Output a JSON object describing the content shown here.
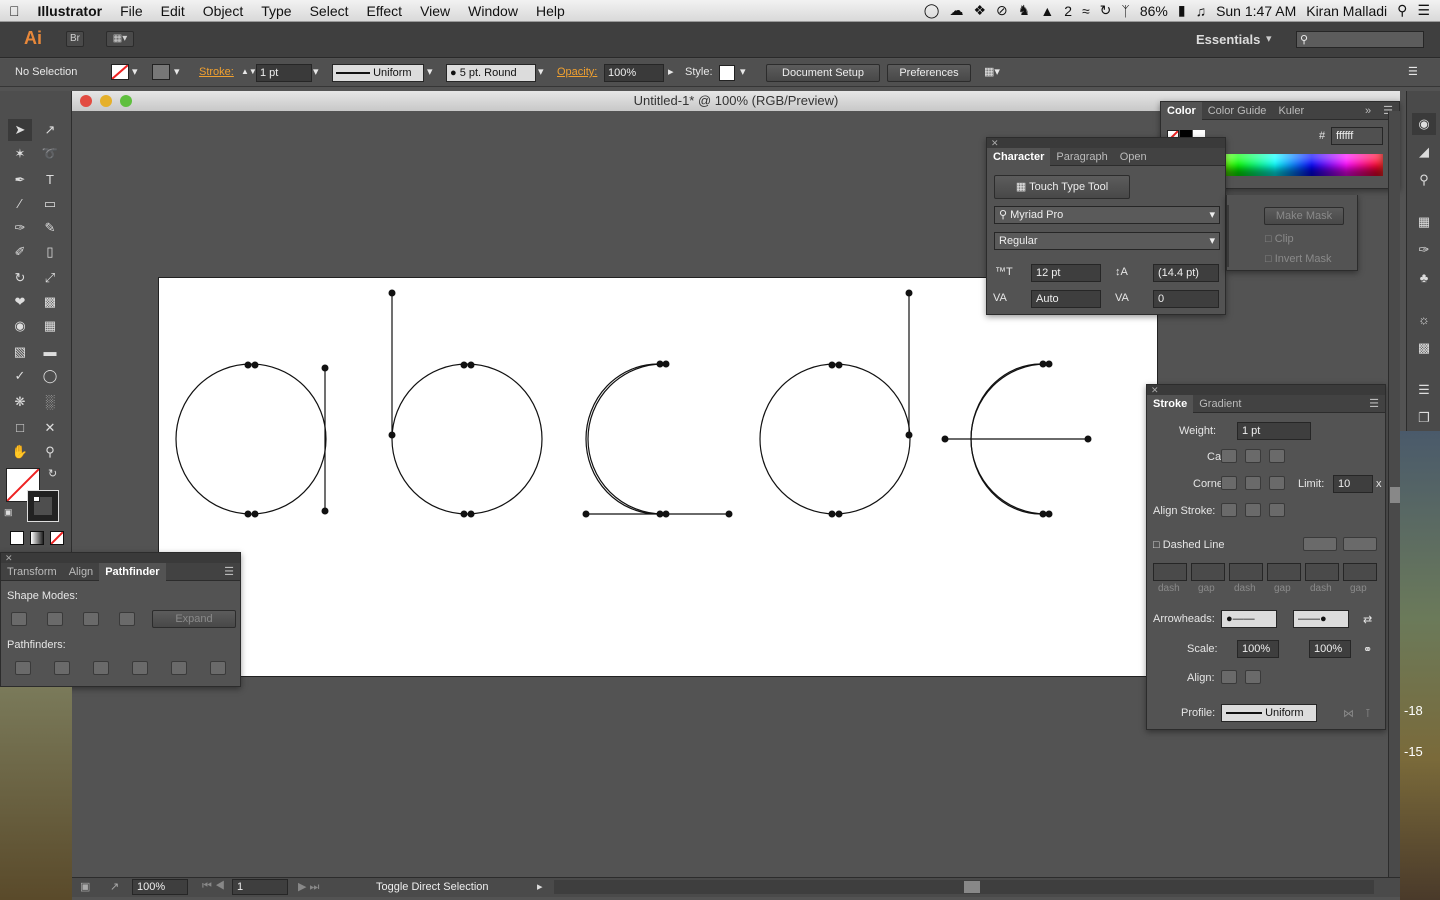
{
  "menubar": {
    "items": [
      "Illustrator",
      "File",
      "Edit",
      "Object",
      "Type",
      "Select",
      "Effect",
      "View",
      "Window",
      "Help"
    ],
    "battery": "86%",
    "adobe_count": "2",
    "clock": "Sun 1:47 AM",
    "user": "Kiran Malladi"
  },
  "appbar": {
    "logo": "Ai",
    "bridge": "Br",
    "workspace": "Essentials"
  },
  "control": {
    "selection": "No Selection",
    "stroke_label": "Stroke:",
    "stroke_value": "1 pt",
    "profile": "Uniform",
    "brush": "5 pt. Round",
    "opacity_label": "Opacity:",
    "opacity_value": "100%",
    "style_label": "Style:",
    "doc_setup": "Document Setup",
    "preferences": "Preferences"
  },
  "document": {
    "title": "Untitled-1* @ 100% (RGB/Preview)"
  },
  "color_panel": {
    "tabs": [
      "Color",
      "Color Guide",
      "Kuler"
    ],
    "hex_label": "#",
    "hex": "ffffff"
  },
  "character_panel": {
    "tabs": [
      "Character",
      "Paragraph",
      "Open"
    ],
    "touch_type": "Touch Type Tool",
    "font": "Myriad Pro",
    "style": "Regular",
    "size": "12 pt",
    "leading": "(14.4 pt)",
    "kerning": "Auto",
    "tracking": "0"
  },
  "transparency": {
    "make_mask": "Make Mask",
    "clip": "Clip",
    "invert": "Invert Mask"
  },
  "stroke_panel": {
    "tabs": [
      "Stroke",
      "Gradient"
    ],
    "weight_label": "Weight:",
    "weight": "1 pt",
    "cap_label": "Cap:",
    "corner_label": "Corner:",
    "limit_label": "Limit:",
    "limit": "10",
    "limit_x": "x",
    "align_label": "Align Stroke:",
    "dashed": "Dashed Line",
    "dash_labels": [
      "dash",
      "gap",
      "dash",
      "gap",
      "dash",
      "gap"
    ],
    "arrowheads_label": "Arrowheads:",
    "scale_label": "Scale:",
    "scale1": "100%",
    "scale2": "100%",
    "align2_label": "Align:",
    "profile_label": "Profile:",
    "profile": "Uniform"
  },
  "pathfinder": {
    "tabs": [
      "Transform",
      "Align",
      "Pathfinder"
    ],
    "shape_modes": "Shape Modes:",
    "expand": "Expand",
    "pathfinders": "Pathfinders:"
  },
  "status": {
    "zoom": "100%",
    "page": "1",
    "tool": "Toggle Direct Selection"
  },
  "desktop": {
    "n1": "-18",
    "n2": "-15"
  }
}
